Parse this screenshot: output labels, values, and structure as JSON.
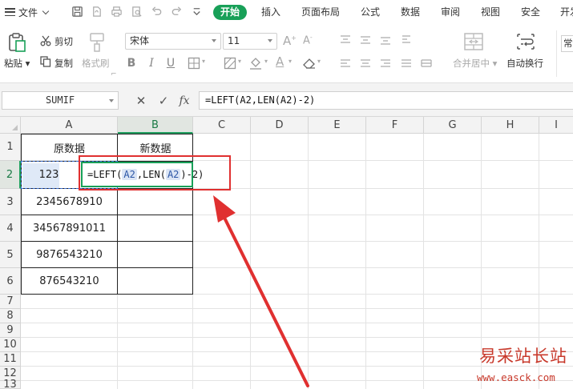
{
  "menubar": {
    "file_label": "文件",
    "tabs": [
      {
        "label": "开始",
        "active": true
      },
      {
        "label": "插入"
      },
      {
        "label": "页面布局"
      },
      {
        "label": "公式"
      },
      {
        "label": "数据"
      },
      {
        "label": "审阅"
      },
      {
        "label": "视图"
      },
      {
        "label": "安全"
      },
      {
        "label": "开发"
      }
    ]
  },
  "ribbon": {
    "paste_label": "粘贴",
    "cut_label": "剪切",
    "copy_label": "复制",
    "format_painter_label": "格式刷",
    "font_name": "宋体",
    "font_size": "11",
    "merge_center_label": "合并居中",
    "wrap_text_label": "自动换行",
    "general_label": "常"
  },
  "formula_bar": {
    "name_box": "SUMIF",
    "fx_label": "fx",
    "formula": "=LEFT(A2,LEN(A2)-2)"
  },
  "sheet": {
    "columns": [
      "A",
      "B",
      "C",
      "D",
      "E",
      "F",
      "G",
      "H",
      "I"
    ],
    "rows": [
      "1",
      "2",
      "3",
      "4",
      "5",
      "6",
      "7",
      "8",
      "9",
      "10",
      "11",
      "12",
      "13"
    ],
    "header_a": "原数据",
    "header_b": "新数据",
    "data_a": [
      "123",
      "2345678910",
      "34567891011",
      "9876543210",
      "876543210"
    ],
    "edit_formula": {
      "prefix": "=LEFT(",
      "ref1": "A2",
      "mid": ",LEN(",
      "ref2": "A2",
      "suffix": ")-2)"
    }
  },
  "watermark": {
    "title": "易采站长站",
    "url": "www.easck.com"
  },
  "colors": {
    "accent_green": "#18a058",
    "annotation_red": "#e03030",
    "reference_blue": "#2c56a6"
  }
}
